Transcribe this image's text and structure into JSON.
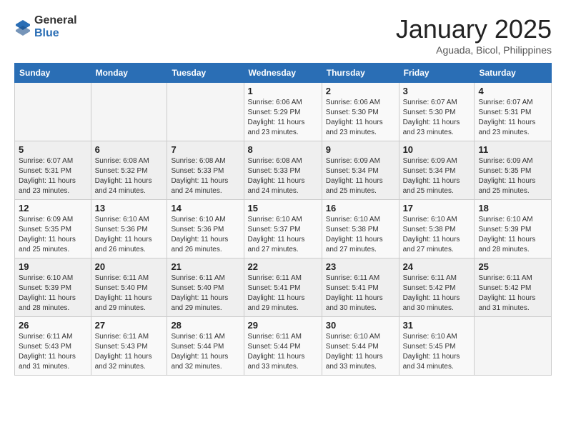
{
  "header": {
    "logo_line1": "General",
    "logo_line2": "Blue",
    "month_title": "January 2025",
    "location": "Aguada, Bicol, Philippines"
  },
  "weekdays": [
    "Sunday",
    "Monday",
    "Tuesday",
    "Wednesday",
    "Thursday",
    "Friday",
    "Saturday"
  ],
  "weeks": [
    [
      {
        "day": "",
        "info": ""
      },
      {
        "day": "",
        "info": ""
      },
      {
        "day": "",
        "info": ""
      },
      {
        "day": "1",
        "info": "Sunrise: 6:06 AM\nSunset: 5:29 PM\nDaylight: 11 hours\nand 23 minutes."
      },
      {
        "day": "2",
        "info": "Sunrise: 6:06 AM\nSunset: 5:30 PM\nDaylight: 11 hours\nand 23 minutes."
      },
      {
        "day": "3",
        "info": "Sunrise: 6:07 AM\nSunset: 5:30 PM\nDaylight: 11 hours\nand 23 minutes."
      },
      {
        "day": "4",
        "info": "Sunrise: 6:07 AM\nSunset: 5:31 PM\nDaylight: 11 hours\nand 23 minutes."
      }
    ],
    [
      {
        "day": "5",
        "info": "Sunrise: 6:07 AM\nSunset: 5:31 PM\nDaylight: 11 hours\nand 23 minutes."
      },
      {
        "day": "6",
        "info": "Sunrise: 6:08 AM\nSunset: 5:32 PM\nDaylight: 11 hours\nand 24 minutes."
      },
      {
        "day": "7",
        "info": "Sunrise: 6:08 AM\nSunset: 5:33 PM\nDaylight: 11 hours\nand 24 minutes."
      },
      {
        "day": "8",
        "info": "Sunrise: 6:08 AM\nSunset: 5:33 PM\nDaylight: 11 hours\nand 24 minutes."
      },
      {
        "day": "9",
        "info": "Sunrise: 6:09 AM\nSunset: 5:34 PM\nDaylight: 11 hours\nand 25 minutes."
      },
      {
        "day": "10",
        "info": "Sunrise: 6:09 AM\nSunset: 5:34 PM\nDaylight: 11 hours\nand 25 minutes."
      },
      {
        "day": "11",
        "info": "Sunrise: 6:09 AM\nSunset: 5:35 PM\nDaylight: 11 hours\nand 25 minutes."
      }
    ],
    [
      {
        "day": "12",
        "info": "Sunrise: 6:09 AM\nSunset: 5:35 PM\nDaylight: 11 hours\nand 25 minutes."
      },
      {
        "day": "13",
        "info": "Sunrise: 6:10 AM\nSunset: 5:36 PM\nDaylight: 11 hours\nand 26 minutes."
      },
      {
        "day": "14",
        "info": "Sunrise: 6:10 AM\nSunset: 5:36 PM\nDaylight: 11 hours\nand 26 minutes."
      },
      {
        "day": "15",
        "info": "Sunrise: 6:10 AM\nSunset: 5:37 PM\nDaylight: 11 hours\nand 27 minutes."
      },
      {
        "day": "16",
        "info": "Sunrise: 6:10 AM\nSunset: 5:38 PM\nDaylight: 11 hours\nand 27 minutes."
      },
      {
        "day": "17",
        "info": "Sunrise: 6:10 AM\nSunset: 5:38 PM\nDaylight: 11 hours\nand 27 minutes."
      },
      {
        "day": "18",
        "info": "Sunrise: 6:10 AM\nSunset: 5:39 PM\nDaylight: 11 hours\nand 28 minutes."
      }
    ],
    [
      {
        "day": "19",
        "info": "Sunrise: 6:10 AM\nSunset: 5:39 PM\nDaylight: 11 hours\nand 28 minutes."
      },
      {
        "day": "20",
        "info": "Sunrise: 6:11 AM\nSunset: 5:40 PM\nDaylight: 11 hours\nand 29 minutes."
      },
      {
        "day": "21",
        "info": "Sunrise: 6:11 AM\nSunset: 5:40 PM\nDaylight: 11 hours\nand 29 minutes."
      },
      {
        "day": "22",
        "info": "Sunrise: 6:11 AM\nSunset: 5:41 PM\nDaylight: 11 hours\nand 29 minutes."
      },
      {
        "day": "23",
        "info": "Sunrise: 6:11 AM\nSunset: 5:41 PM\nDaylight: 11 hours\nand 30 minutes."
      },
      {
        "day": "24",
        "info": "Sunrise: 6:11 AM\nSunset: 5:42 PM\nDaylight: 11 hours\nand 30 minutes."
      },
      {
        "day": "25",
        "info": "Sunrise: 6:11 AM\nSunset: 5:42 PM\nDaylight: 11 hours\nand 31 minutes."
      }
    ],
    [
      {
        "day": "26",
        "info": "Sunrise: 6:11 AM\nSunset: 5:43 PM\nDaylight: 11 hours\nand 31 minutes."
      },
      {
        "day": "27",
        "info": "Sunrise: 6:11 AM\nSunset: 5:43 PM\nDaylight: 11 hours\nand 32 minutes."
      },
      {
        "day": "28",
        "info": "Sunrise: 6:11 AM\nSunset: 5:44 PM\nDaylight: 11 hours\nand 32 minutes."
      },
      {
        "day": "29",
        "info": "Sunrise: 6:11 AM\nSunset: 5:44 PM\nDaylight: 11 hours\nand 33 minutes."
      },
      {
        "day": "30",
        "info": "Sunrise: 6:10 AM\nSunset: 5:44 PM\nDaylight: 11 hours\nand 33 minutes."
      },
      {
        "day": "31",
        "info": "Sunrise: 6:10 AM\nSunset: 5:45 PM\nDaylight: 11 hours\nand 34 minutes."
      },
      {
        "day": "",
        "info": ""
      }
    ]
  ]
}
